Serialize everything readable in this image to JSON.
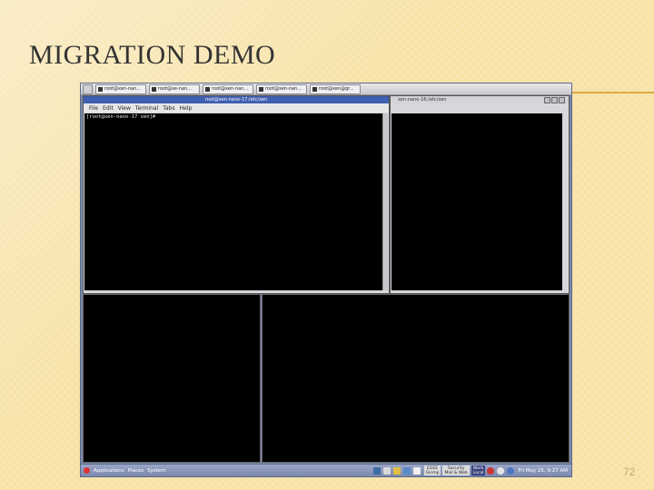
{
  "slide": {
    "title": "MIGRATION DEMO",
    "page_number": "72",
    "accent_color": "#e0a93c"
  },
  "taskbar": {
    "buttons": [
      {
        "label": "root@xen-nan...",
        "icon": "terminal-icon"
      },
      {
        "label": "root@xe-nan...",
        "icon": "terminal-icon"
      },
      {
        "label": "root@xen-nan...",
        "icon": "terminal-icon"
      },
      {
        "label": "root@xen-nan...",
        "icon": "terminal-icon"
      },
      {
        "label": "root@xen@gr...",
        "icon": "terminal-icon"
      }
    ]
  },
  "windows": {
    "main": {
      "title": "root@xen-nano-17:/etc/xen",
      "menu": [
        "File",
        "Edit",
        "View",
        "Terminal",
        "Tabs",
        "Help"
      ],
      "prompt": "[root@xen-nano-17 xen]#"
    },
    "right": {
      "title": "xen-nano-16:/etc/xen"
    }
  },
  "panel": {
    "applications": "Applications",
    "places": "Places",
    "system": "System",
    "tray_buttons": [
      {
        "line1": "EGEE",
        "line2": "Ginmp"
      },
      {
        "line1": "Security",
        "line2": "Mail & Web"
      },
      {
        "line1": "Work",
        "line2": "Local"
      }
    ],
    "clock": "Fri May 25,  9:27 AM"
  }
}
